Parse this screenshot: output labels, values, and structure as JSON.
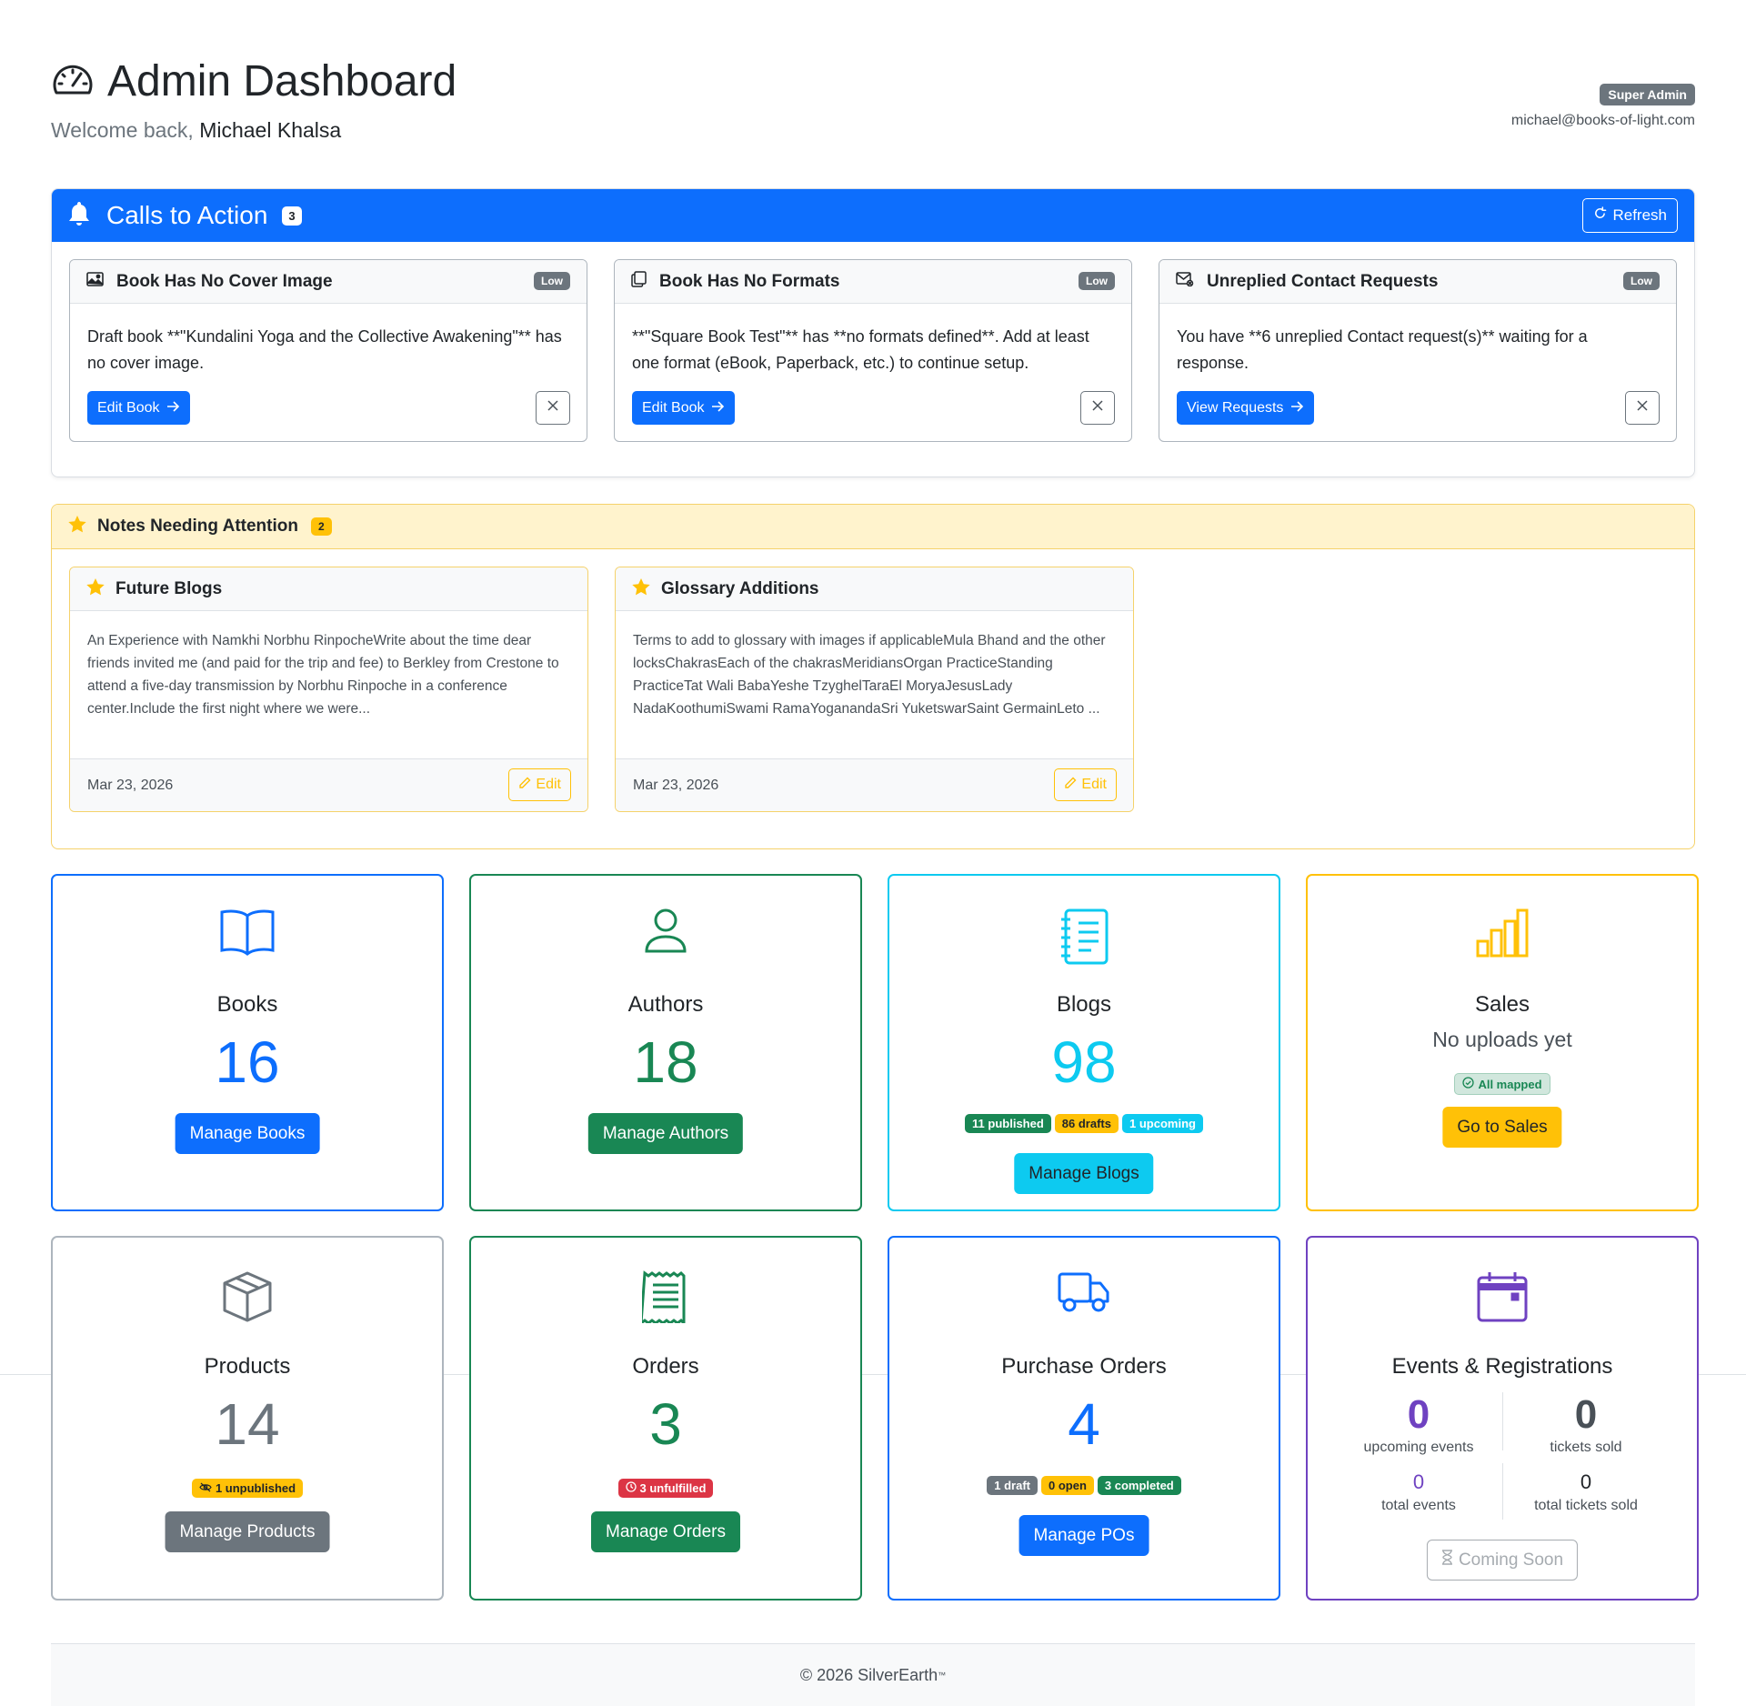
{
  "header": {
    "title": "Admin Dashboard",
    "welcome_prefix": "Welcome back,",
    "user_name": "Michael Khalsa",
    "role": "Super Admin",
    "email": "michael@books-of-light.com"
  },
  "cta": {
    "title": "Calls to Action",
    "count": "3",
    "refresh_label": "Refresh",
    "cards": [
      {
        "title": "Book Has No Cover Image",
        "priority": "Low",
        "body": "Draft book **\"Kundalini Yoga and the Collective Awakening\"** has no cover image.",
        "action": "Edit Book",
        "icon": "image-icon"
      },
      {
        "title": "Book Has No Formats",
        "priority": "Low",
        "body": "**\"Square Book Test\"** has **no formats defined**. Add at least one format (eBook, Paperback, etc.) to continue setup.",
        "action": "Edit Book",
        "icon": "copy-icon"
      },
      {
        "title": "Unreplied Contact Requests",
        "priority": "Low",
        "body": "You have **6 unreplied Contact request(s)** waiting for a response.",
        "action": "View Requests",
        "icon": "envelope-icon"
      }
    ]
  },
  "notes": {
    "title": "Notes Needing Attention",
    "count": "2",
    "items": [
      {
        "title": "Future Blogs",
        "body": "An Experience with Namkhi Norbhu RinpocheWrite about the time dear friends invited me (and paid for the trip and fee) to Berkley from Crestone to attend a five-day transmission by Norbhu Rinpoche in a conference center.Include the first night where we were...",
        "date": "Mar 23, 2026",
        "edit_label": "Edit"
      },
      {
        "title": "Glossary Additions",
        "body": "Terms to add to glossary with images if applicableMula Bhand and the other locksChakrasEach of the chakrasMeridiansOrgan PracticeStanding PracticeTat Wali BabaYeshe TzyghelTaraEl MoryaJesusLady NadaKoothumiSwami RamaYoganandaSri YuketswarSaint GermainLeto ...",
        "date": "Mar 23, 2026",
        "edit_label": "Edit"
      }
    ]
  },
  "stats": {
    "books": {
      "name": "Books",
      "value": "16",
      "button": "Manage Books",
      "color": "#0d6efd"
    },
    "authors": {
      "name": "Authors",
      "value": "18",
      "button": "Manage Authors",
      "color": "#198754"
    },
    "blogs": {
      "name": "Blogs",
      "value": "98",
      "button": "Manage Blogs",
      "color": "#0dcaf0",
      "pills": {
        "published": "11 published",
        "drafts": "86 drafts",
        "upcoming": "1 upcoming"
      }
    },
    "sales": {
      "name": "Sales",
      "subtitle": "No uploads yet",
      "mapped": "All mapped",
      "button": "Go to Sales",
      "color": "#ffc107"
    },
    "products": {
      "name": "Products",
      "value": "14",
      "pill": "1 unpublished",
      "button": "Manage Products",
      "color": "#6c757d"
    },
    "orders": {
      "name": "Orders",
      "value": "3",
      "pill": "3 unfulfilled",
      "button": "Manage Orders",
      "color": "#198754"
    },
    "purchase_orders": {
      "name": "Purchase Orders",
      "value": "4",
      "button": "Manage POs",
      "color": "#0d6efd",
      "pills": {
        "draft": "1 draft",
        "open": "0 open",
        "completed": "3 completed"
      }
    },
    "events": {
      "name": "Events & Registrations",
      "upcoming_events": "0",
      "upcoming_events_label": "upcoming events",
      "tickets_sold": "0",
      "tickets_sold_label": "tickets sold",
      "total_events": "0",
      "total_events_label": "total events",
      "total_tickets_sold": "0",
      "total_tickets_sold_label": "total tickets sold",
      "button": "Coming Soon",
      "color": "#6f42c1"
    }
  },
  "footer": {
    "text": "© 2026 SilverEarth",
    "tm": "™"
  }
}
